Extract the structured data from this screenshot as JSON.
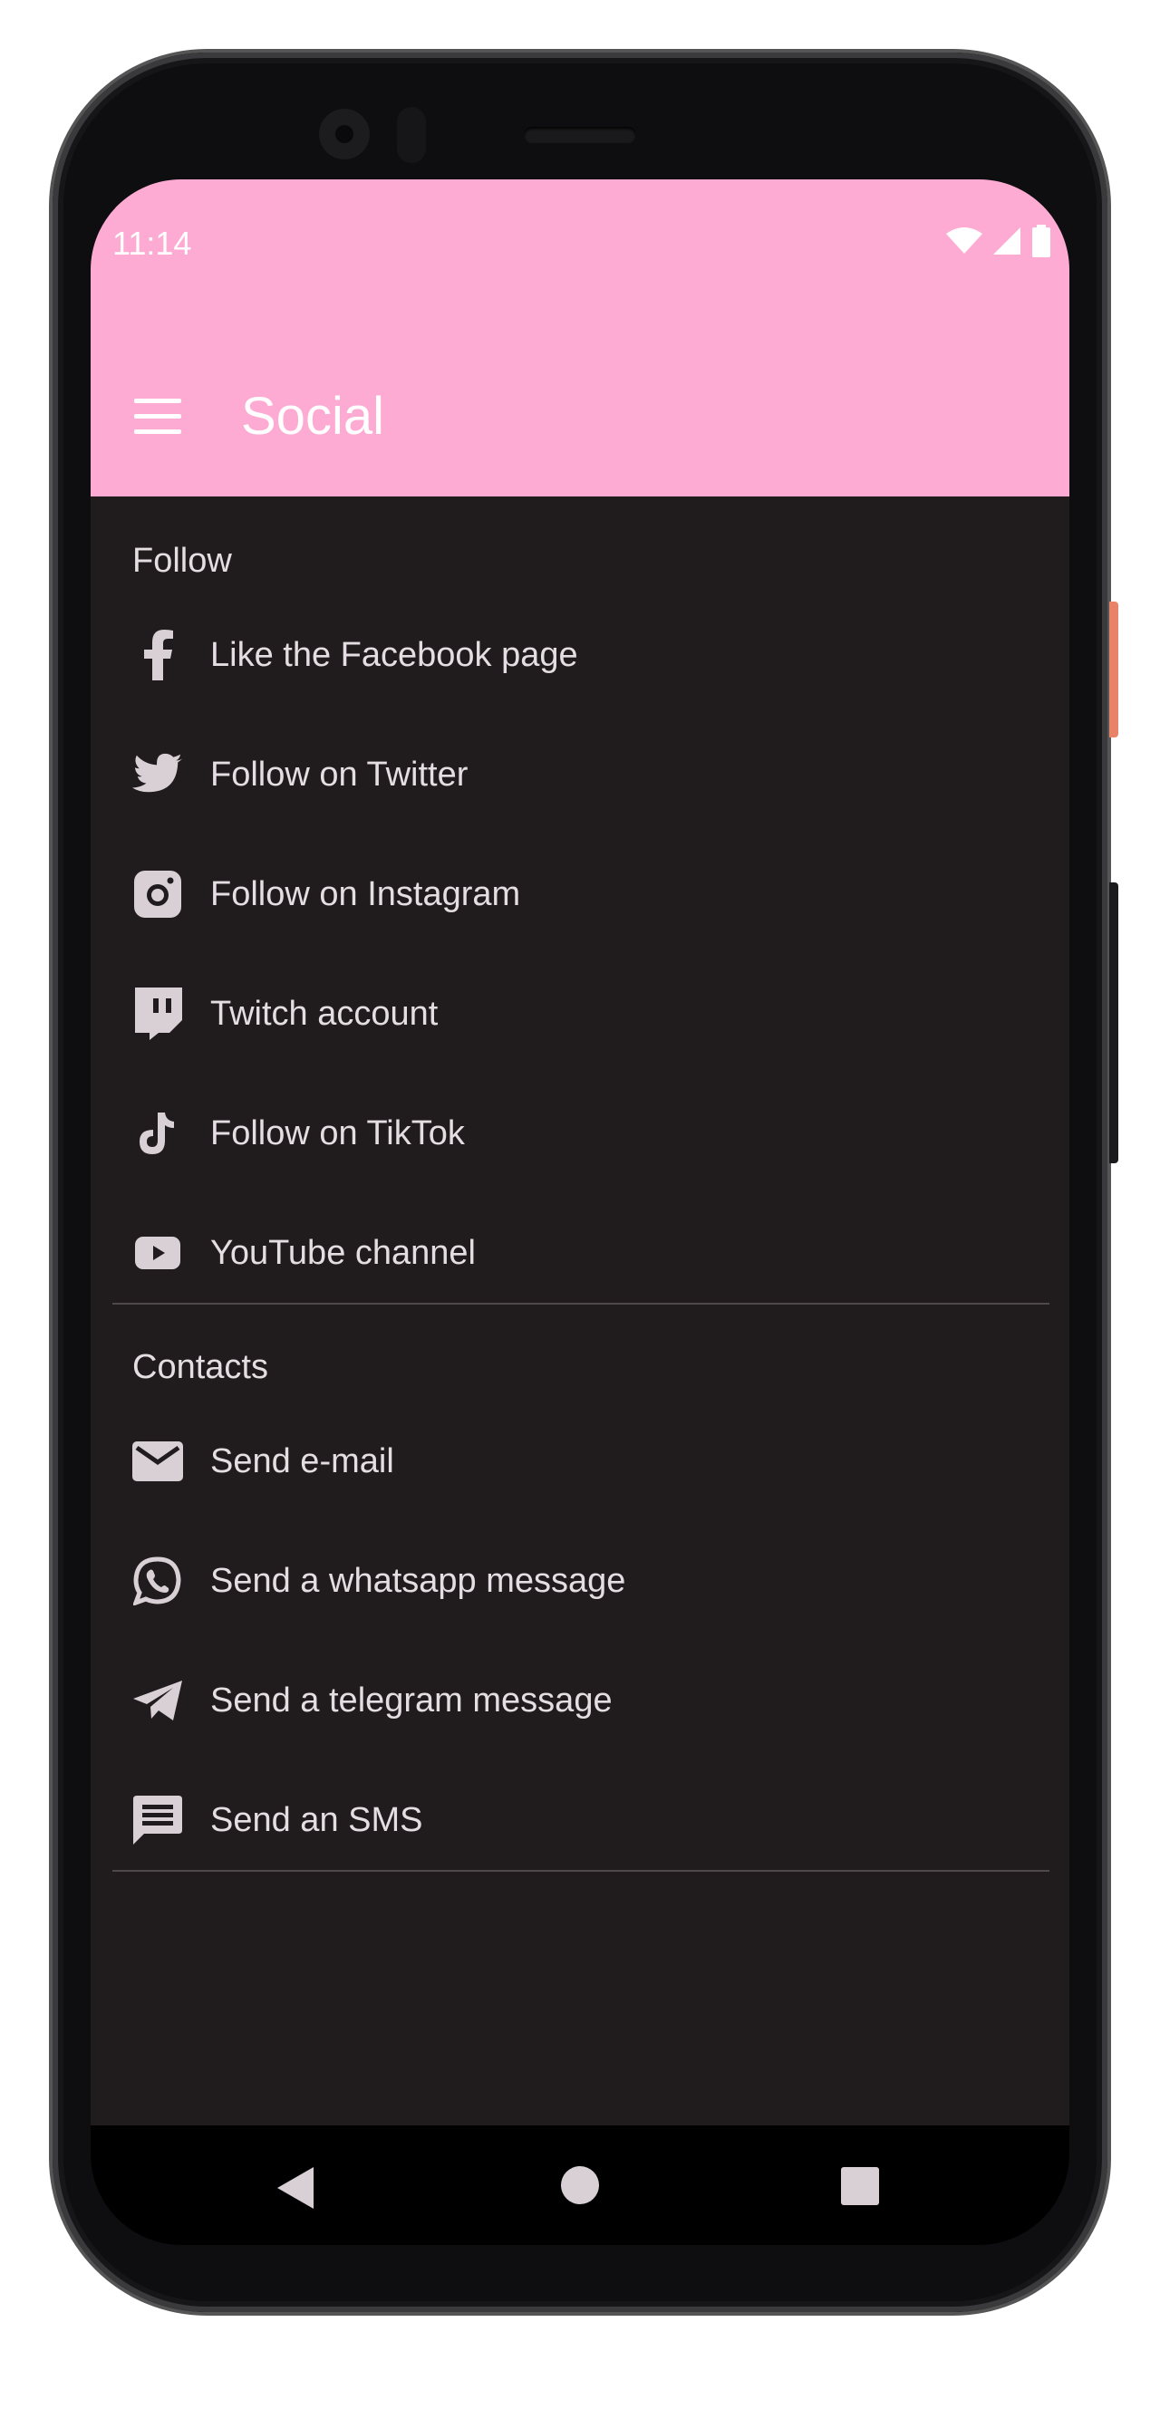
{
  "status_bar": {
    "time": "11:14"
  },
  "app_bar": {
    "title": "Social"
  },
  "sections": [
    {
      "title": "Follow",
      "items": [
        {
          "label": "Like the Facebook page",
          "icon": "facebook-icon"
        },
        {
          "label": "Follow on Twitter",
          "icon": "twitter-icon"
        },
        {
          "label": "Follow on Instagram",
          "icon": "instagram-icon"
        },
        {
          "label": "Twitch account",
          "icon": "twitch-icon"
        },
        {
          "label": "Follow on TikTok",
          "icon": "tiktok-icon"
        },
        {
          "label": "YouTube channel",
          "icon": "youtube-icon"
        }
      ]
    },
    {
      "title": "Contacts",
      "items": [
        {
          "label": "Send e-mail",
          "icon": "email-icon"
        },
        {
          "label": "Send a whatsapp message",
          "icon": "whatsapp-icon"
        },
        {
          "label": "Send a telegram message",
          "icon": "telegram-icon"
        },
        {
          "label": "Send an SMS",
          "icon": "sms-icon"
        }
      ]
    }
  ],
  "navigation_bar": {
    "buttons": [
      "back-icon",
      "home-icon",
      "recents-icon"
    ]
  },
  "colors": {
    "app_bar": "#fdabd3",
    "background": "#201c1e",
    "text": "#e4dde1",
    "icon": "#d8d0d5",
    "divider": "#4e474b"
  }
}
